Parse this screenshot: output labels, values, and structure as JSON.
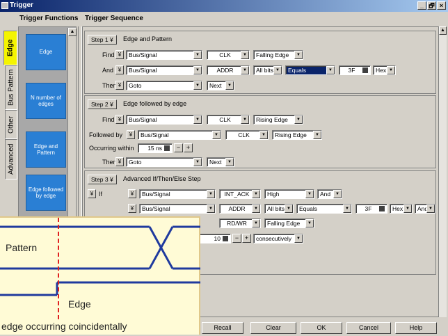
{
  "window": {
    "title": "Trigger",
    "min_label": "_",
    "restore_label": "🗗",
    "close_label": "×"
  },
  "headers": {
    "functions": "Trigger Functions",
    "sequence": "Trigger Sequence"
  },
  "side_tabs": [
    {
      "label": "Edge",
      "active": true
    },
    {
      "label": "Bus Pattern",
      "active": false
    },
    {
      "label": "Other",
      "active": false
    },
    {
      "label": "Advanced",
      "active": false
    }
  ],
  "functions": [
    {
      "label": "Edge"
    },
    {
      "label": "N number of edges"
    },
    {
      "label": "Edge and Pattern"
    },
    {
      "label": "Edge followed by edge"
    }
  ],
  "step1": {
    "button": "Step 1",
    "title": "Edge and Pattern",
    "row_find": {
      "label": "Find",
      "source": "Bus/Signal",
      "signal": "CLK",
      "edge": "Falling Edge"
    },
    "row_and": {
      "label": "And",
      "source": "Bus/Signal",
      "signal": "ADDR",
      "bits": "All bits",
      "op": "Equals",
      "value": "3F",
      "radix": "Hex"
    },
    "row_then": {
      "label": "Then",
      "action": "Goto",
      "target": "Next"
    }
  },
  "step2": {
    "button": "Step 2",
    "title": "Edge followed by edge",
    "row_find": {
      "label": "Find",
      "source": "Bus/Signal",
      "signal": "CLK",
      "edge": "Rising Edge"
    },
    "row_followed": {
      "label": "Followed by",
      "source": "Bus/Signal",
      "signal": "CLK",
      "edge": "Rising Edge"
    },
    "row_within": {
      "label": "Occurring within",
      "value": "15 ns",
      "minus": "−",
      "plus": "+"
    },
    "row_then": {
      "label": "Then",
      "action": "Goto",
      "target": "Next"
    }
  },
  "step3": {
    "button": "Step 3",
    "title": "Advanced If/Then/Else Step",
    "if_label": "If",
    "row1": {
      "source": "Bus/Signal",
      "signal": "INT_ACK",
      "level": "High",
      "logic": "And"
    },
    "row2": {
      "source": "Bus/Signal",
      "signal": "ADDR",
      "bits": "All bits",
      "op": "Equals",
      "value": "3F",
      "radix": "Hex",
      "logic": "And"
    },
    "row3": {
      "signal": "RD/WR",
      "edge": "Falling Edge"
    },
    "row4": {
      "count": "10",
      "minus": "−",
      "plus": "+",
      "mode": "consecutively"
    }
  },
  "bottom_buttons": [
    "Recall",
    "Clear",
    "OK",
    "Cancel",
    "Help"
  ],
  "overlay": {
    "pattern_label": "Pattern",
    "edge_label": "Edge",
    "caption": "edge occurring coincidentally"
  },
  "colors": {
    "function_button": "#2a7fd4",
    "active_tab": "#f4f400",
    "overlay_bg": "#fffbd6",
    "waveform": "#1f3a9e",
    "marker": "#e02020"
  }
}
